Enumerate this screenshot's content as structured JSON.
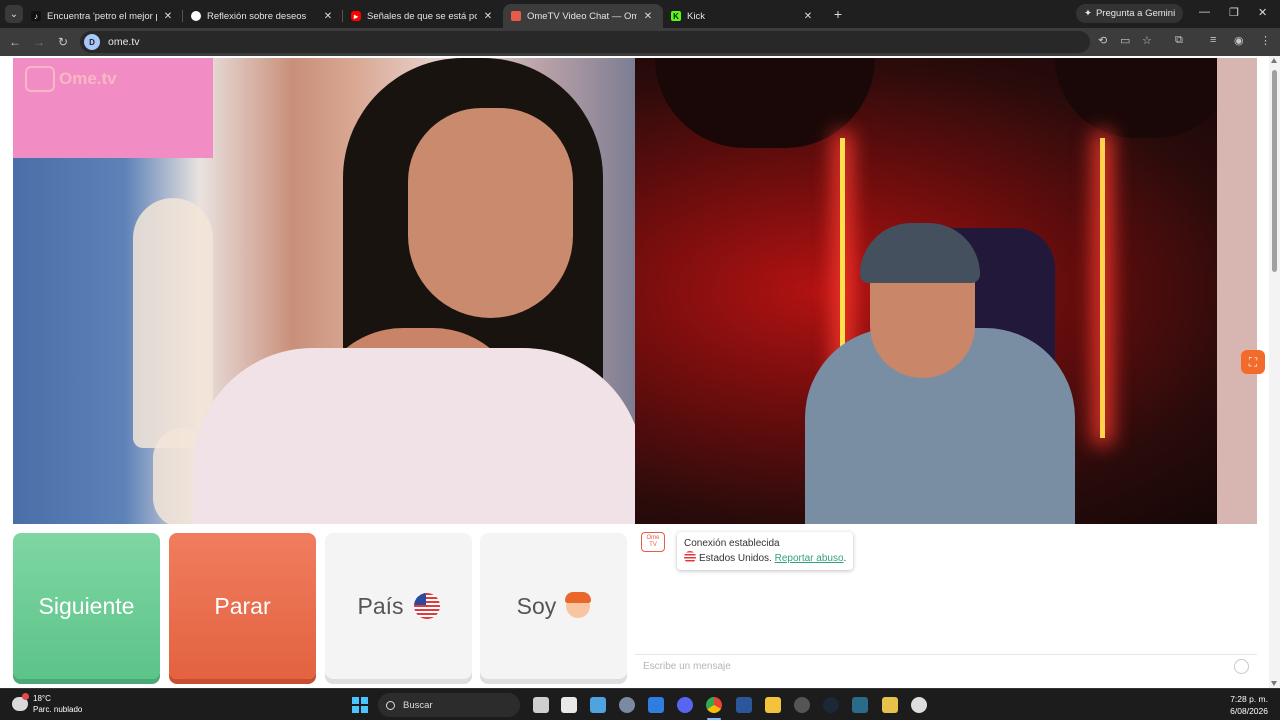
{
  "browser": {
    "tabs": [
      {
        "title": "Encuentra 'petro el mejor presi",
        "favicon": "tiktok-icon",
        "color": "#111111"
      },
      {
        "title": "Reflexión sobre deseos",
        "favicon": "openai-icon",
        "color": "#444444"
      },
      {
        "title": "Señales de que se está ponienc",
        "favicon": "youtube-icon",
        "color": "#ff0000"
      },
      {
        "title": "OmeTV Video Chat — Ome",
        "favicon": "ometv-icon",
        "color": "#e85b4a",
        "active": true
      },
      {
        "title": "Kick",
        "favicon": "kick-icon",
        "color": "#53fc18"
      }
    ],
    "close_glyph": "✕",
    "new_tab_glyph": "+",
    "gemini_label": "Pregunta a Gemini",
    "url": "ome.tv",
    "site_badge": "D"
  },
  "page": {
    "logo_text": "Ome.tv",
    "logo_box": "Ome TV",
    "buttons": {
      "siguiente": "Siguiente",
      "parar": "Parar",
      "pais": "País",
      "soy": "Soy"
    },
    "chat": {
      "avatar": "Ome TV",
      "connection": "Conexión establecida",
      "country": "Estados Unidos.",
      "report": "Reportar abuso",
      "report_suffix": ".",
      "placeholder": "Escribe un mensaje"
    }
  },
  "taskbar": {
    "temp": "18°C",
    "weather": "Parc. nublado",
    "search_label": "Buscar",
    "time": "7:28 p. m.",
    "date": "6/08/2026"
  },
  "colors": {
    "siguiente": "#5cc389",
    "parar": "#e3623f",
    "accent": "#34a27a"
  }
}
